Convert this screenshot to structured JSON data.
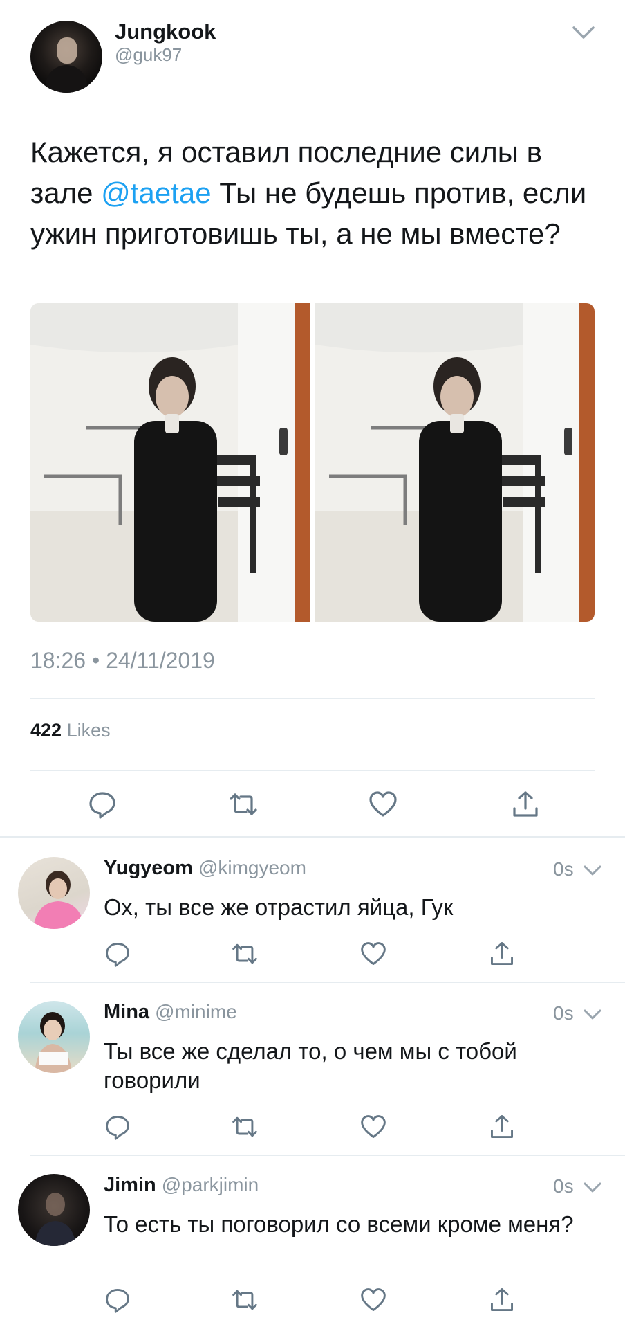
{
  "tweet": {
    "author": {
      "name": "Jungkook",
      "handle": "@guk97"
    },
    "text_before": "Кажется, я оставил последние силы в зале ",
    "mention": "@taetae",
    "text_after": " Ты не будешь против, если ужин приготовишь ты, а не мы вместе?",
    "timestamp": "18:26 • 24/11/2019",
    "likes_count": "422",
    "likes_label": "Likes"
  },
  "replies": [
    {
      "name": "Yugyeom",
      "handle": "@kimgyeom",
      "time": "0s",
      "text": "Ох, ты все же отрастил яйца, Гук"
    },
    {
      "name": "Mina",
      "handle": "@minime",
      "time": "0s",
      "text": "Ты все же сделал то, о чем мы с тобой говорили"
    },
    {
      "name": "Jimin",
      "handle": "@parkjimin",
      "time": "0s",
      "text": "То есть ты поговорил со всеми кроме меня?"
    }
  ],
  "icons": {
    "reply": "reply-icon",
    "retweet": "retweet-icon",
    "like": "heart-icon",
    "share": "share-icon",
    "more": "chevron-down-icon"
  },
  "colors": {
    "accent": "#1da1f2",
    "secondary_text": "#8a959e",
    "icon": "#657786",
    "divider": "#e6ecf0"
  }
}
